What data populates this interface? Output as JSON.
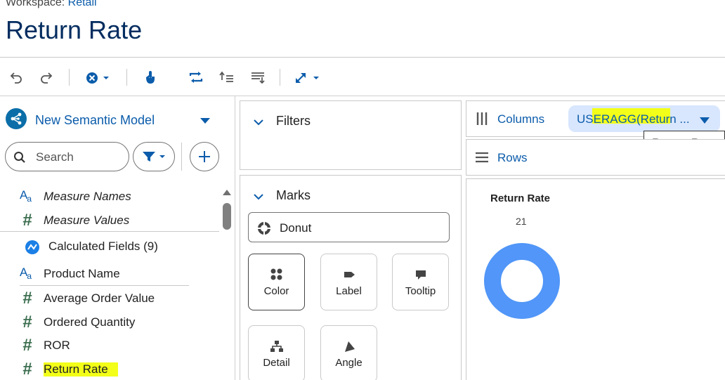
{
  "header": {
    "workspace_prefix": "Workspace:",
    "workspace_name": "Retail",
    "title": "Return Rate"
  },
  "toolbar": {
    "icons": [
      "undo-icon",
      "redo-icon",
      "clear-icon",
      "touch-icon",
      "swap-icon",
      "sort-ascending-icon",
      "sort-descending-icon",
      "fit-icon"
    ]
  },
  "left_panel": {
    "model_name": "New Semantic Model",
    "search_placeholder": "Search",
    "fields": [
      {
        "icon": "text",
        "label": "Measure Names",
        "italic": true
      },
      {
        "icon": "number",
        "label": "Measure Values",
        "italic": true
      },
      {
        "icon": "calc",
        "label": "Calculated Fields (9)",
        "italic": false
      },
      {
        "icon": "text",
        "label": "Product Name",
        "italic": false
      },
      {
        "icon": "number",
        "label": "Average Order Value",
        "italic": false
      },
      {
        "icon": "number",
        "label": "Ordered Quantity",
        "italic": false
      },
      {
        "icon": "number",
        "label": "ROR",
        "italic": false
      },
      {
        "icon": "number",
        "label": "Return Rate",
        "italic": false,
        "highlighted": true
      }
    ]
  },
  "middle_panel": {
    "filters_label": "Filters",
    "marks_label": "Marks",
    "mark_type": "Donut",
    "mark_buttons": [
      "Color",
      "Label",
      "Tooltip",
      "Detail",
      "Angle"
    ]
  },
  "right_panel": {
    "columns_label": "Columns",
    "columns_pill": "USERAGG(Return ...",
    "rows_label": "Rows",
    "tooltip": "Return Rate"
  },
  "chart_data": {
    "type": "pie",
    "title": "Return Rate",
    "values": [
      21
    ],
    "value_label": "21",
    "colors": [
      "#5196f8"
    ]
  },
  "colors": {
    "brand_blue": "#0b5cab",
    "title_navy": "#032d60",
    "highlight": "#f3ff18",
    "pill_bg": "#d8e6fe",
    "donut": "#5196f8"
  }
}
